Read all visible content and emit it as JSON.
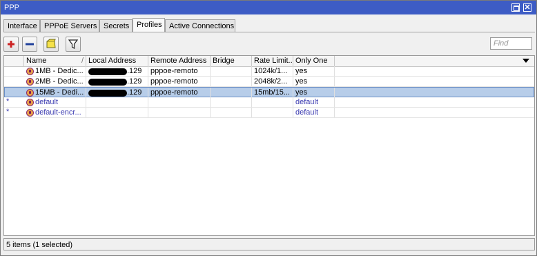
{
  "window": {
    "title": "PPP"
  },
  "tabs": [
    {
      "label": "Interface"
    },
    {
      "label": "PPPoE Servers"
    },
    {
      "label": "Secrets"
    },
    {
      "label": "Profiles",
      "active": true
    },
    {
      "label": "Active Connections"
    }
  ],
  "toolbar": {
    "add_icon": "plus-icon",
    "remove_icon": "minus-icon",
    "comment_icon": "note-icon",
    "filter_icon": "filter-icon",
    "find_placeholder": "Find"
  },
  "table": {
    "columns": [
      "Name",
      "Local Address",
      "Remote Address",
      "Bridge",
      "Rate Limit...",
      "Only One"
    ],
    "sort_marker": "/",
    "rows": [
      {
        "flag": "",
        "name": "1MB - Dedic...",
        "local": ".129",
        "remote": "pppoe-remoto",
        "bridge": "",
        "rate": "1024k/1...",
        "only_one": "yes",
        "selected": false
      },
      {
        "flag": "",
        "name": "2MB - Dedic...",
        "local": ".129",
        "remote": "pppoe-remoto",
        "bridge": "",
        "rate": "2048k/2...",
        "only_one": "yes",
        "selected": false
      },
      {
        "flag": "",
        "name": "15MB - Dedi...",
        "local": ".129",
        "remote": "pppoe-remoto",
        "bridge": "",
        "rate": "15mb/15...",
        "only_one": "yes",
        "selected": true
      },
      {
        "flag": "*",
        "name": "default",
        "local": "",
        "remote": "",
        "bridge": "",
        "rate": "",
        "only_one": "default",
        "selected": false
      },
      {
        "flag": "*",
        "name": "default-encr...",
        "local": "",
        "remote": "",
        "bridge": "",
        "rate": "",
        "only_one": "default",
        "selected": false
      }
    ]
  },
  "status": {
    "text": "5 items (1 selected)"
  },
  "colors": {
    "titlebar": "#3d5cc5",
    "selection": "#b7cde9",
    "dynamic_text": "#3a3ab0",
    "add_red": "#cc2222",
    "remove_blue": "#1f3f9a"
  }
}
